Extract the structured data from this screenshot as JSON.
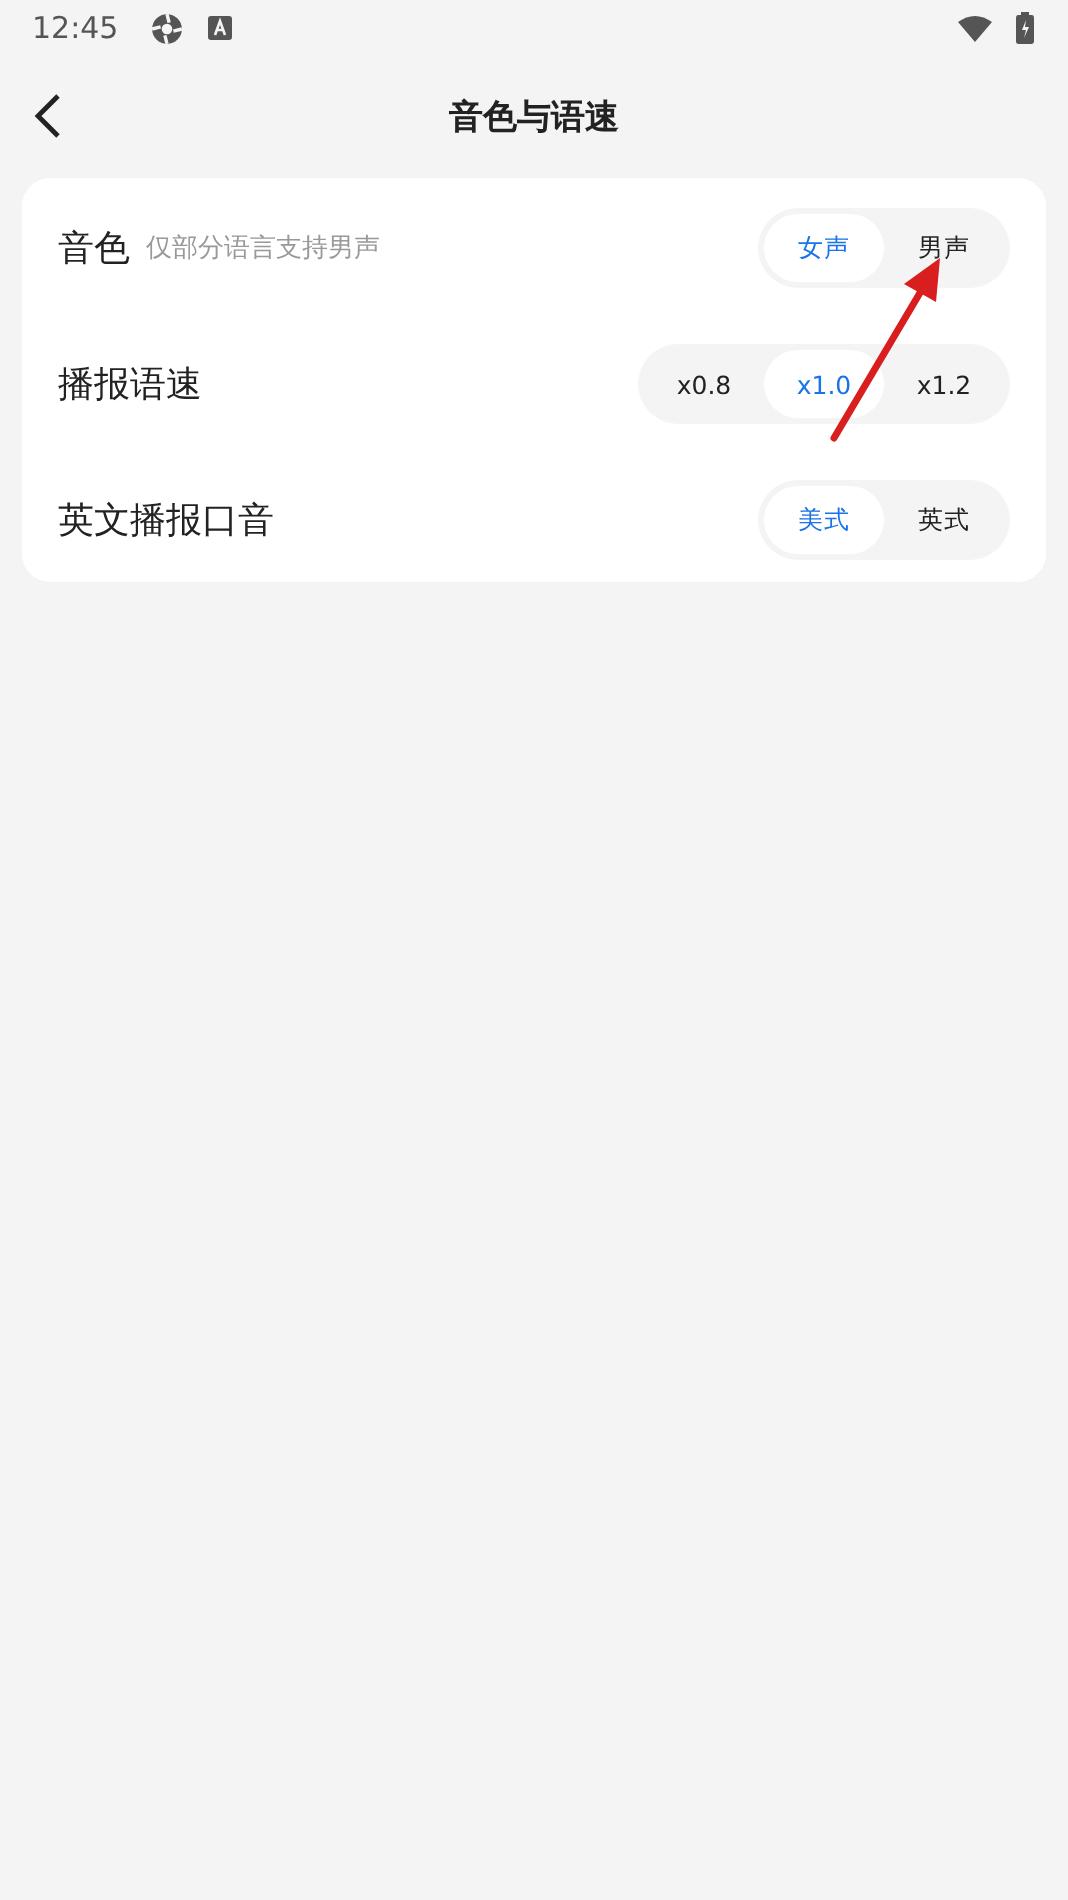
{
  "status_bar": {
    "time": "12:45"
  },
  "header": {
    "title": "音色与语速"
  },
  "settings": [
    {
      "label": "音色",
      "hint": "仅部分语言支持男声",
      "options": [
        {
          "label": "女声",
          "selected": true
        },
        {
          "label": "男声",
          "selected": false
        }
      ]
    },
    {
      "label": "播报语速",
      "options": [
        {
          "label": "x0.8",
          "selected": false
        },
        {
          "label": "x1.0",
          "selected": true
        },
        {
          "label": "x1.2",
          "selected": false
        }
      ]
    },
    {
      "label": "英文播报口音",
      "options": [
        {
          "label": "美式",
          "selected": true
        },
        {
          "label": "英式",
          "selected": false
        }
      ]
    }
  ]
}
